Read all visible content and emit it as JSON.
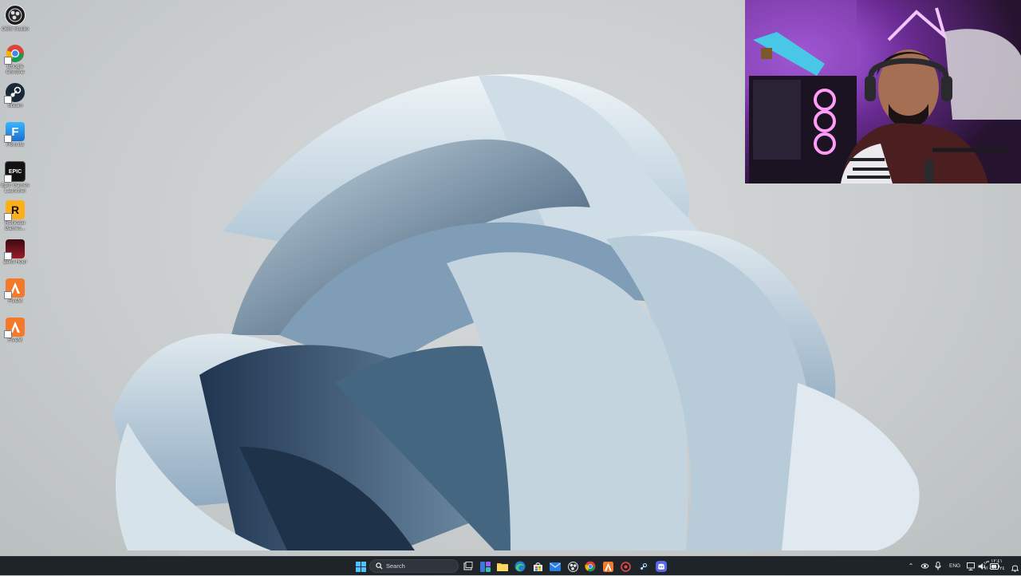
{
  "desktop": {
    "icons": [
      {
        "label": "OBS Studio",
        "icon": "obs-icon",
        "color": "#1d1d1f"
      },
      {
        "label": "Google Chrome",
        "icon": "chrome-icon",
        "color": "#ffffff"
      },
      {
        "label": "Steam",
        "icon": "steam-icon",
        "color": "#1b2838"
      },
      {
        "label": "Fortnite",
        "icon": "fortnite-icon",
        "color": "#2aa0e8"
      },
      {
        "label": "Epic Games Launcher",
        "icon": "epic-games-icon",
        "color": "#121212"
      },
      {
        "label": "Rockstar Games...",
        "icon": "rockstar-icon",
        "color": "#fcaf17"
      },
      {
        "label": "Zero Hour",
        "icon": "zero-hour-icon",
        "color": "#7a1420"
      },
      {
        "label": "FiveM",
        "icon": "fivem-icon",
        "color": "#f27a2a"
      },
      {
        "label": "FiveM",
        "icon": "fivem-icon",
        "color": "#f27a2a"
      }
    ]
  },
  "webcam": {
    "name": "webcam-overlay",
    "accent": "#b05cff"
  },
  "taskbar": {
    "search": {
      "label": "Search"
    },
    "apps": [
      {
        "name": "start",
        "icon": "windows-start-icon",
        "color": "#3aa0ff"
      },
      {
        "name": "task-view",
        "icon": "task-view-icon",
        "color": "#d0d4d8"
      },
      {
        "name": "widgets",
        "icon": "widgets-icon",
        "color": "#7b6cff"
      },
      {
        "name": "file-explorer",
        "icon": "folder-icon",
        "color": "#f5c542"
      },
      {
        "name": "edge",
        "icon": "edge-icon",
        "color": "#2fb7d6"
      },
      {
        "name": "store",
        "icon": "store-icon",
        "color": "#6b8cff"
      },
      {
        "name": "mail",
        "icon": "mail-icon",
        "color": "#2a7de1"
      },
      {
        "name": "obs",
        "icon": "obs-icon",
        "color": "#dfe2e5"
      },
      {
        "name": "chrome",
        "icon": "chrome-icon",
        "color": "#34a853"
      },
      {
        "name": "fivem",
        "icon": "fivem-icon",
        "color": "#f27a2a"
      },
      {
        "name": "rockstar-launcher",
        "icon": "rockstar-icon",
        "color": "#e5484d"
      },
      {
        "name": "steam",
        "icon": "steam-icon",
        "color": "#cfe3f5"
      },
      {
        "name": "discord",
        "icon": "discord-icon",
        "color": "#5865f2"
      }
    ],
    "tray": {
      "language": "ENG",
      "time": "١٢:٤١ ص",
      "date": "٢٧/٠٦/٢٠٢٤",
      "icons": [
        "chevron-up-icon",
        "nvidia-icon",
        "microphone-icon",
        "network-icon",
        "volume-icon",
        "battery-icon"
      ]
    }
  }
}
